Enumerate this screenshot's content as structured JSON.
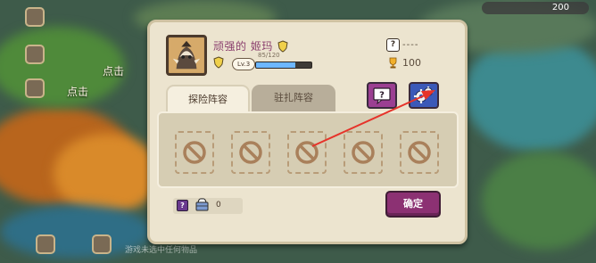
{
  "background": {
    "tap_hint_1": "点击",
    "tap_hint_2": "点击",
    "top_right_value": "200",
    "bottom_hint": "游戏未选中任何物品"
  },
  "profile": {
    "name": "顽强的 姬玛",
    "level": "Lv.3",
    "exp_text": "85/120",
    "exp_fraction": 0.71,
    "rank": "----",
    "trophies": "100"
  },
  "tabs": {
    "adventure": "探险阵容",
    "garrison": "驻扎阵容"
  },
  "slots": [
    "empty",
    "empty",
    "empty",
    "empty",
    "empty"
  ],
  "footer": {
    "help": "?",
    "count": "0",
    "confirm": "确定"
  },
  "icons": {
    "help": "help-icon",
    "settings": "gears-icon",
    "slot": "no-entry-icon",
    "trophy": "trophy-icon",
    "shield": "shield-icon"
  },
  "colors": {
    "dialog_bg": "#ece4cf",
    "name": "#8a3e6d",
    "confirm": "#8c3173",
    "help_button": "#9b3f92",
    "settings_button": "#3b59b8",
    "annotation_arrow": "#e6332a"
  }
}
